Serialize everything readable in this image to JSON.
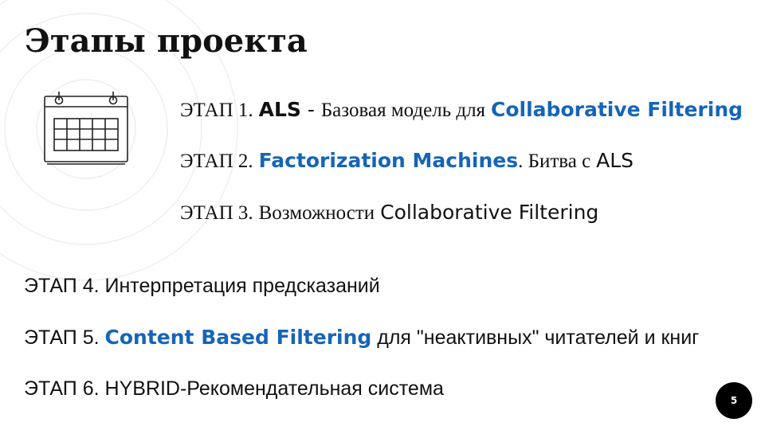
{
  "slide": {
    "title": "Этапы проекта",
    "page_number": "5"
  },
  "icons": {
    "calendar": "calendar-icon"
  },
  "colors": {
    "accent": "#1565b8",
    "text": "#111111",
    "badge_bg": "#000000",
    "rings": "#eeeeee"
  },
  "stages": [
    {
      "prefix": "ЭТАП 1.",
      "name": "ALS",
      "separator": " - ",
      "desc": "Базовая модель для",
      "highlight": "Collaborative Filtering"
    },
    {
      "prefix": "ЭТАП 2.",
      "highlight": "Factorization Machines",
      "desc": ". Битва с",
      "tail": "ALS"
    },
    {
      "prefix": "ЭТАП 3.",
      "desc": "Возможности",
      "tail": "Collaborative Filtering"
    },
    {
      "text": "ЭТАП 4. Интерпретация предсказаний"
    },
    {
      "prefix": "ЭТАП 5.",
      "highlight": "Content Based Filtering",
      "desc": "для \"неактивных\" читателей и книг"
    },
    {
      "text": "ЭТАП 6. HYBRID-Рекомендательная система"
    }
  ]
}
